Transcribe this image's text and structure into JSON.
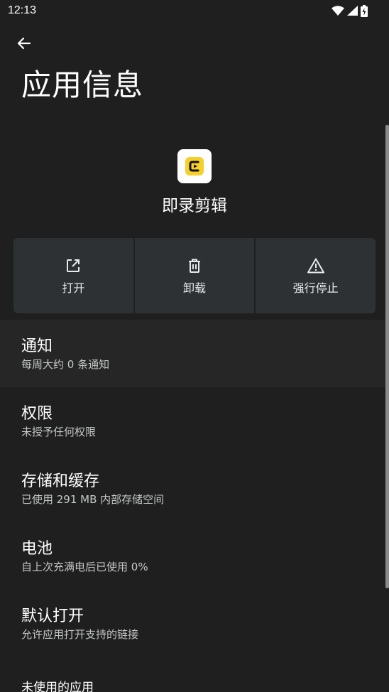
{
  "status_bar": {
    "time": "12:13",
    "icons": [
      "wifi-icon",
      "cellular-signal-icon",
      "battery-charging-icon"
    ]
  },
  "header": {
    "back_icon": "arrow-left-icon",
    "title": "应用信息"
  },
  "app": {
    "name": "即录剪辑",
    "icon_color": "#f5d02a"
  },
  "actions": [
    {
      "icon": "open-external-icon",
      "label": "打开"
    },
    {
      "icon": "trash-icon",
      "label": "卸载"
    },
    {
      "icon": "warning-icon",
      "label": "强行停止"
    }
  ],
  "settings": [
    {
      "title": "通知",
      "subtitle": "每周大约 0 条通知"
    },
    {
      "title": "权限",
      "subtitle": "未授予任何权限"
    },
    {
      "title": "存储和缓存",
      "subtitle": "已使用 291 MB 内部存储空间"
    },
    {
      "title": "电池",
      "subtitle": "自上次充满电后已使用 0%"
    },
    {
      "title": "默认打开",
      "subtitle": "允许应用打开支持的链接"
    },
    {
      "title": "未使用的应用"
    }
  ],
  "colors": {
    "background": "#1f1f1f",
    "button_bg": "#2e3134",
    "accent_yellow": "#f5d02a"
  }
}
